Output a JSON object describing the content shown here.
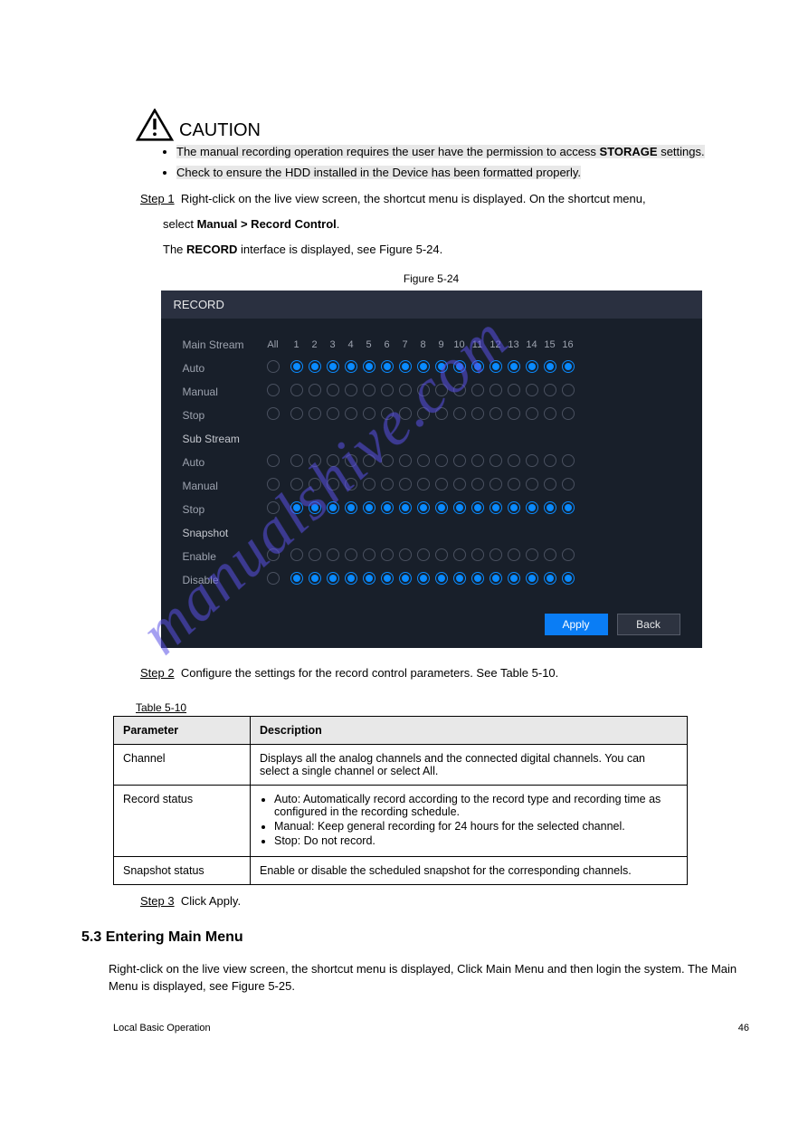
{
  "caution": {
    "label": "CAUTION",
    "bullet1a": "The manual recording operation requires the user have the permission to access ",
    "bullet1b": "STORAGE",
    "bullet1c": " settings.",
    "bullet2": "Check to ensure the HDD installed in the Device has been formatted properly."
  },
  "step1": {
    "label": "Step 1",
    "text": "Right-click on the live view screen, the shortcut menu is displayed. On the shortcut menu,",
    "line2a": "select ",
    "line2b": "Manual > Record Control",
    "line2c": ".",
    "line3a": "The ",
    "line3b": "RECORD",
    "line3c": " interface is displayed, see Figure 5-24."
  },
  "figcap": "Figure 5-24",
  "record": {
    "title": "RECORD",
    "headers": {
      "label": "Main Stream",
      "all": "All",
      "channels": [
        "1",
        "2",
        "3",
        "4",
        "5",
        "6",
        "7",
        "8",
        "9",
        "10",
        "11",
        "12",
        "13",
        "14",
        "15",
        "16"
      ]
    },
    "sections": [
      {
        "title": "Main Stream",
        "rows": [
          {
            "label": "Auto",
            "all": false,
            "checked": true
          },
          {
            "label": "Manual",
            "all": false,
            "checked": false
          },
          {
            "label": "Stop",
            "all": false,
            "checked": false
          }
        ]
      },
      {
        "title": "Sub Stream",
        "rows": [
          {
            "label": "Auto",
            "all": false,
            "checked": false
          },
          {
            "label": "Manual",
            "all": false,
            "checked": false
          },
          {
            "label": "Stop",
            "all": false,
            "checked": true
          }
        ]
      },
      {
        "title": "Snapshot",
        "rows": [
          {
            "label": "Enable",
            "all": false,
            "checked": false
          },
          {
            "label": "Disable",
            "all": false,
            "checked": true
          }
        ]
      }
    ],
    "apply": "Apply",
    "back": "Back"
  },
  "step2": {
    "label": "Step 2",
    "text": "Configure the settings for the record control parameters. See Table 5-10.",
    "tablecap": "Table 5-10",
    "th1": "Parameter",
    "th2": "Description",
    "rows": [
      {
        "p": "Channel",
        "d": "Displays all the analog channels and the connected digital channels. You can select a single channel or select All."
      },
      {
        "p": "Record status",
        "lead": "",
        "items": [
          "Auto: Automatically record according to the record type and recording time as configured in the recording schedule.",
          "Manual: Keep general recording for 24 hours for the selected channel.",
          "Stop: Do not record."
        ]
      },
      {
        "p": "Snapshot status",
        "d": "Enable or disable the scheduled snapshot for the corresponding channels."
      }
    ]
  },
  "step3": {
    "label": "Step 3",
    "text": "Click Apply."
  },
  "section53": {
    "heading": "5.3  Entering Main Menu",
    "p1": "Right-click on the live view screen, the shortcut menu is displayed, Click Main Menu and then login the system. The Main Menu is displayed, see Figure 5-25."
  },
  "footer": {
    "left": "Local Basic Operation",
    "right": "46"
  },
  "watermark": "manualshive.com"
}
